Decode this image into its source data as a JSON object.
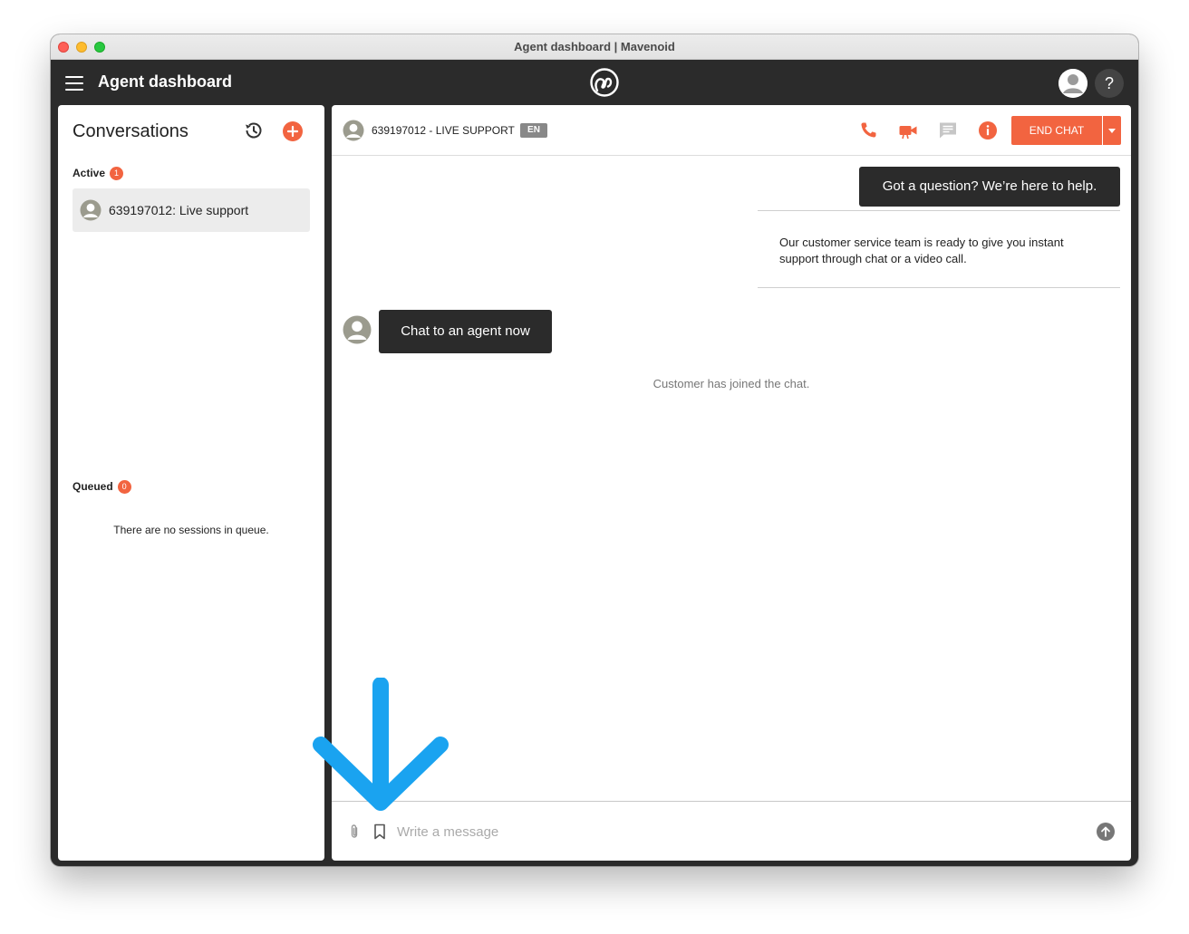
{
  "window": {
    "title": "Agent dashboard | Mavenoid"
  },
  "appbar": {
    "title": "Agent dashboard",
    "help_label": "?"
  },
  "sidebar": {
    "title": "Conversations",
    "active": {
      "label": "Active",
      "count": "1"
    },
    "conversations": [
      {
        "label": "639197012: Live support"
      }
    ],
    "queued": {
      "label": "Queued",
      "count": "0",
      "empty_text": "There are no sessions in queue."
    }
  },
  "chat": {
    "header": {
      "title": "639197012 - LIVE SUPPORT",
      "language": "EN",
      "end_chat_label": "END CHAT"
    },
    "messages": {
      "bot_greeting": "Got a question? We’re here to help.",
      "info_text": "Our customer service team is ready to give you instant support through chat or a video call.",
      "customer_reply": "Chat to an agent now",
      "system_notice": "Customer has joined the chat."
    },
    "composer": {
      "placeholder": "Write a message"
    }
  },
  "colors": {
    "accent": "#f26440",
    "dark": "#2b2b2b",
    "annotation": "#1aa3f0"
  },
  "icons": [
    "menu-icon",
    "mavenoid-logo-icon",
    "user-avatar-icon",
    "help-icon",
    "history-icon",
    "add-icon",
    "phone-icon",
    "video-icon",
    "chat-icon",
    "info-icon",
    "chevron-down-icon",
    "paperclip-icon",
    "bookmark-icon",
    "send-icon",
    "arrow-down-annotation"
  ]
}
